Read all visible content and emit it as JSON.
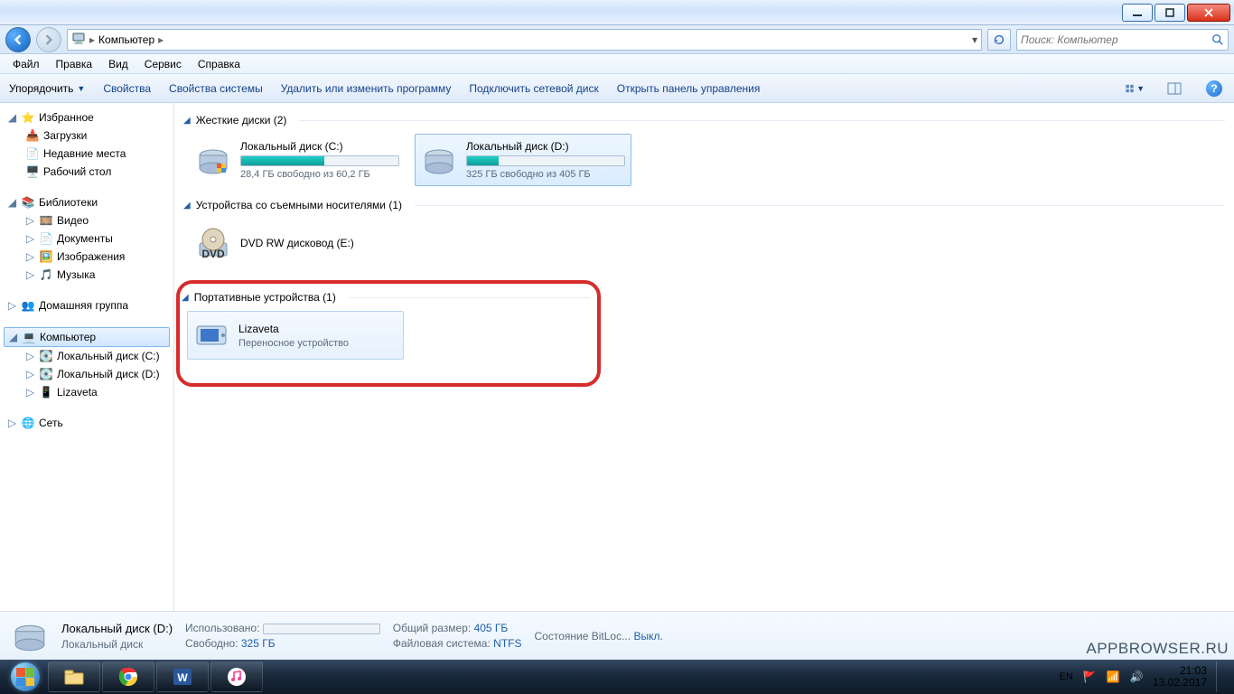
{
  "window": {
    "min_tip": "Свернуть",
    "max_tip": "Развернуть",
    "close_tip": "Закрыть"
  },
  "nav": {
    "back_tip": "Назад",
    "fwd_tip": "Вперёд",
    "crumb_root": "Компьютер",
    "refresh_tip": "Обновить",
    "search_placeholder": "Поиск: Компьютер"
  },
  "menu": {
    "file": "Файл",
    "edit": "Правка",
    "view": "Вид",
    "service": "Сервис",
    "help": "Справка"
  },
  "toolbar": {
    "organize": "Упорядочить",
    "properties": "Свойства",
    "sysprops": "Свойства системы",
    "uninstall": "Удалить или изменить программу",
    "mapdrive": "Подключить сетевой диск",
    "ctrlpanel": "Открыть панель управления"
  },
  "tree": {
    "favorites": "Избранное",
    "downloads": "Загрузки",
    "recent": "Недавние места",
    "desktop": "Рабочий стол",
    "libraries": "Библиотеки",
    "video": "Видео",
    "documents": "Документы",
    "pictures": "Изображения",
    "music": "Музыка",
    "homegroup": "Домашняя группа",
    "computer": "Компьютер",
    "localC": "Локальный диск (C:)",
    "localD": "Локальный диск (D:)",
    "lizaveta": "Lizaveta",
    "network": "Сеть"
  },
  "groups": {
    "hdd": "Жесткие диски (2)",
    "removable": "Устройства со съемными носителями (1)",
    "portable": "Портативные устройства (1)"
  },
  "drives": {
    "c": {
      "name": "Локальный диск (C:)",
      "free": "28,4 ГБ свободно из 60,2 ГБ",
      "pct": 53
    },
    "d": {
      "name": "Локальный диск (D:)",
      "free": "325 ГБ свободно из 405 ГБ",
      "pct": 20
    },
    "dvd": {
      "name": "DVD RW дисковод (E:)"
    },
    "liza": {
      "name": "Lizaveta",
      "sub": "Переносное устройство"
    }
  },
  "details": {
    "title": "Локальный диск (D:)",
    "type": "Локальный диск",
    "used_k": "Использовано:",
    "free_k": "Свободно:",
    "free_v": "325 ГБ",
    "total_k": "Общий размер:",
    "total_v": "405 ГБ",
    "fs_k": "Файловая система:",
    "fs_v": "NTFS",
    "bitlocker_k": "Состояние BitLoc...",
    "bitlocker_v": "Выкл."
  },
  "tray": {
    "lang": "EN",
    "time": "21:03",
    "date": "13.02.2017"
  },
  "watermark": "APPBROWSER.RU"
}
